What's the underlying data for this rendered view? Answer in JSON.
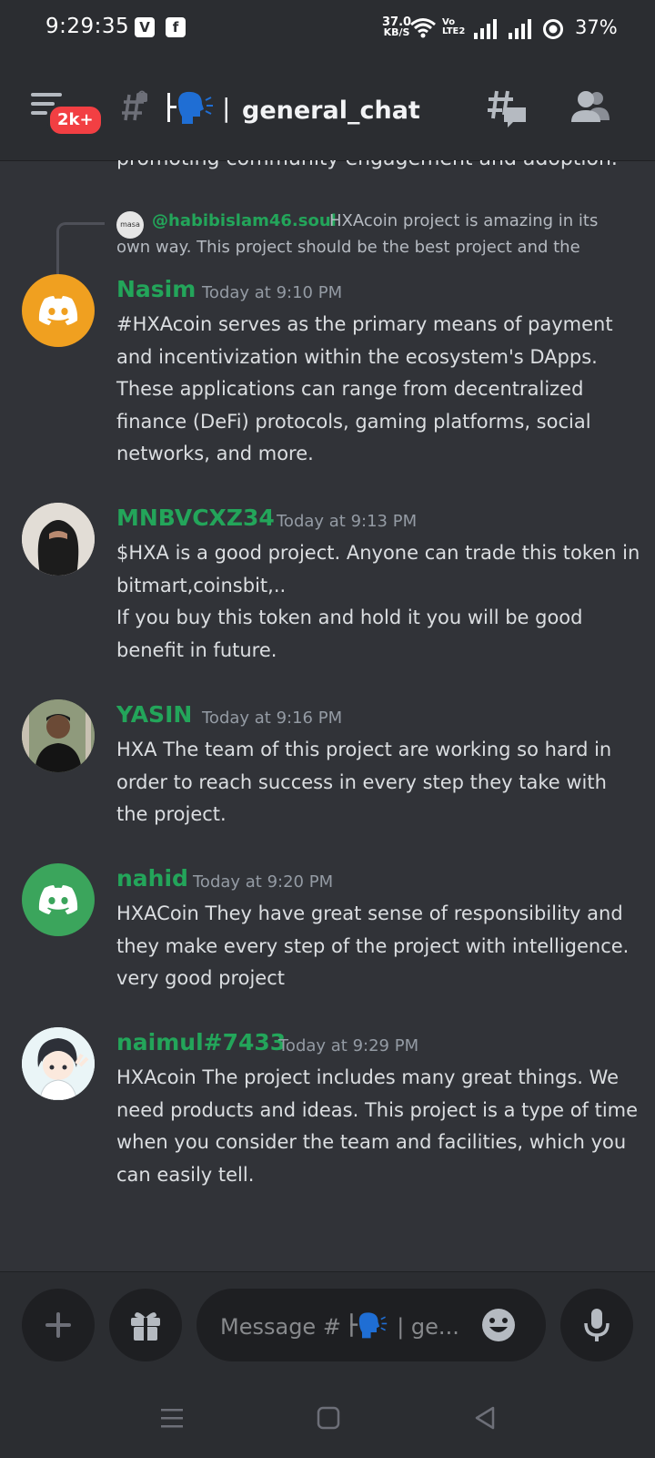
{
  "status_bar": {
    "time": "9:29:35",
    "app_icon_1": "V",
    "app_icon_2": "f",
    "net_speed_value": "37.0",
    "net_speed_unit": "KB/S",
    "volte": "Vo LTE2",
    "battery": "37%"
  },
  "header": {
    "badge": "2k+",
    "channel_name": "general_chat",
    "icons": [
      "menu-icon",
      "locked-channel-icon",
      "speaking-emoji-icon",
      "threads-icon",
      "members-icon"
    ]
  },
  "messages": {
    "cut_off_text": "promoting community engagement and adoption.",
    "reply": {
      "avatar_text": "masa",
      "mention": "@habibislam46.soul",
      "text_line1": "HXAcoin project is amazing in its",
      "text_line2": "own way. This project should be the best project and the"
    },
    "items": [
      {
        "author": "Nasim",
        "timestamp": "Today at 9:10 PM",
        "text": "#HXAcoin serves as the primary means of payment and incentivization within the ecosystem's DApps. These applications can range from decentralized finance (DeFi) protocols, gaming platforms, social networks, and more."
      },
      {
        "author": "MNBVCXZ34",
        "timestamp": "Today at 9:13 PM",
        "line1": "$HXA is a good project. Anyone can trade this token in bitmart,coinsbit,..",
        "line2": "If you buy this token and hold it you will be good benefit in future."
      },
      {
        "author": "YASIN",
        "timestamp": "Today at 9:16 PM",
        "text": "HXA The team of this project are working so hard in order to reach success in every step they take with the project."
      },
      {
        "author": "nahid",
        "timestamp": "Today at 9:20 PM",
        "text": "HXACoin They have great sense of responsibility and they make every step of the project with intelligence. very good project"
      },
      {
        "author": "naimul#7433",
        "timestamp": "Today at 9:29 PM",
        "text": "HXAcoin The project includes many great things. We need products and ideas. This project is a type of time when you consider the team and facilities, which you can easily tell."
      }
    ]
  },
  "composer": {
    "placeholder_prefix": "Message #",
    "placeholder_suffix": "| ge...",
    "icons": [
      "plus-icon",
      "gift-icon",
      "emoji-icon",
      "microphone-icon"
    ]
  },
  "nav": {
    "icons": [
      "recent-apps-icon",
      "home-icon",
      "back-icon"
    ]
  },
  "colors": {
    "background": "#313338",
    "header": "#2b2d31",
    "author_green": "#23a55a",
    "badge_red": "#f23f43",
    "discord_orange": "#f0a020",
    "discord_green": "#3ba55c"
  }
}
